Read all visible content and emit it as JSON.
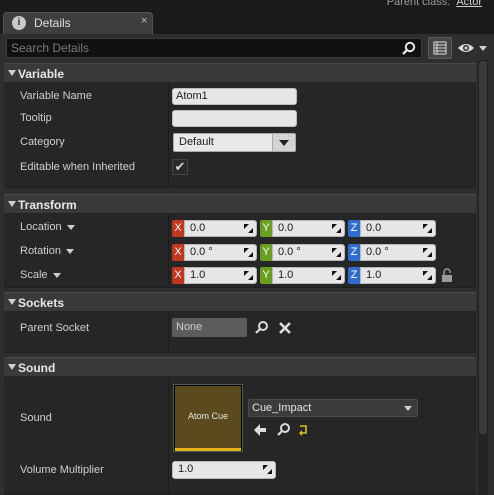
{
  "header": {
    "parent_class_label": "Parent class:",
    "parent_class_value": "Actor"
  },
  "tab": {
    "title": "Details",
    "close": "×"
  },
  "search": {
    "placeholder": "Search Details",
    "value": ""
  },
  "sections": {
    "variable": {
      "title": "Variable",
      "variable_name_label": "Variable Name",
      "variable_name_value": "Atom1",
      "tooltip_label": "Tooltip",
      "tooltip_value": "",
      "category_label": "Category",
      "category_value": "Default",
      "editable_label": "Editable when Inherited",
      "editable_checked": true,
      "check_glyph": "✔"
    },
    "transform": {
      "title": "Transform",
      "location_label": "Location",
      "location": {
        "x": "0.0",
        "y": "0.0",
        "z": "0.0"
      },
      "rotation_label": "Rotation",
      "rotation": {
        "x": "0.0 °",
        "y": "0.0 °",
        "z": "0.0 °"
      },
      "scale_label": "Scale",
      "scale": {
        "x": "1.0",
        "y": "1.0",
        "z": "1.0"
      },
      "axis_x": "X",
      "axis_y": "Y",
      "axis_z": "Z"
    },
    "sockets": {
      "title": "Sockets",
      "parent_socket_label": "Parent Socket",
      "parent_socket_value": "None"
    },
    "sound": {
      "title": "Sound",
      "sound_label": "Sound",
      "thumbnail_label": "Atom Cue",
      "asset_value": "Cue_Impact",
      "volume_label": "Volume Multiplier",
      "volume_value": "1.0"
    }
  },
  "colors": {
    "axis_x": "#c0381f",
    "axis_y": "#6a9e1f",
    "axis_z": "#2e6ccf",
    "thumb_accent": "#e5b11a"
  }
}
